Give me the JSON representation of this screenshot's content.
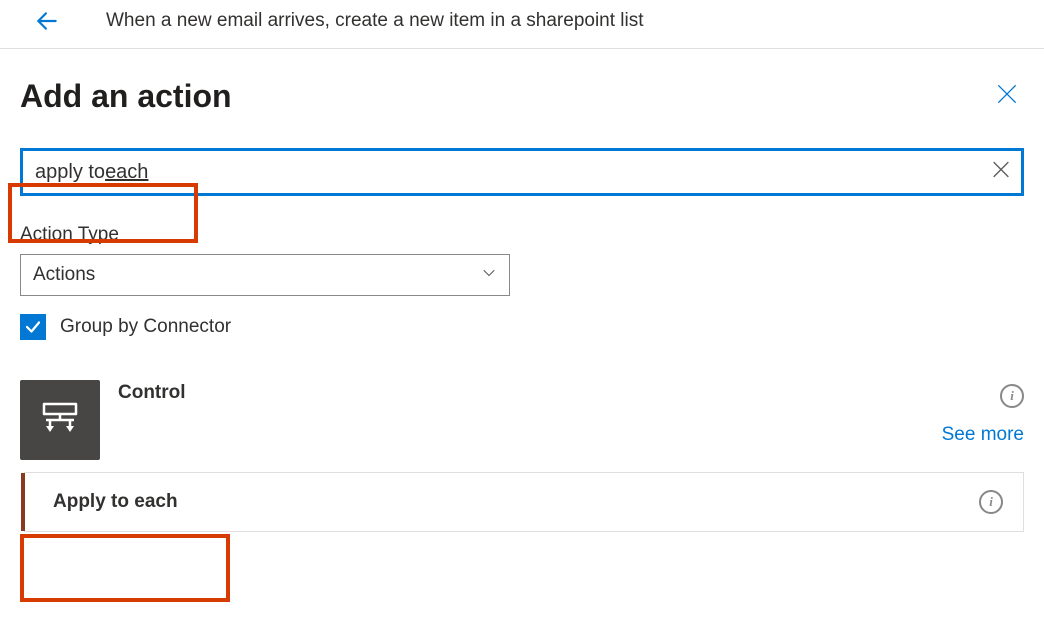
{
  "header": {
    "flow_title": "When a new email arrives, create a new item in a sharepoint list"
  },
  "panel": {
    "title": "Add an action"
  },
  "search": {
    "value": "apply to each",
    "value_part1": "apply to ",
    "value_part2": "each"
  },
  "action_type": {
    "label": "Action Type",
    "selected": "Actions"
  },
  "group_by": {
    "label": "Group by Connector",
    "checked": true
  },
  "connector": {
    "name": "Control",
    "see_more": "See more"
  },
  "actions": [
    {
      "label": "Apply to each"
    }
  ]
}
